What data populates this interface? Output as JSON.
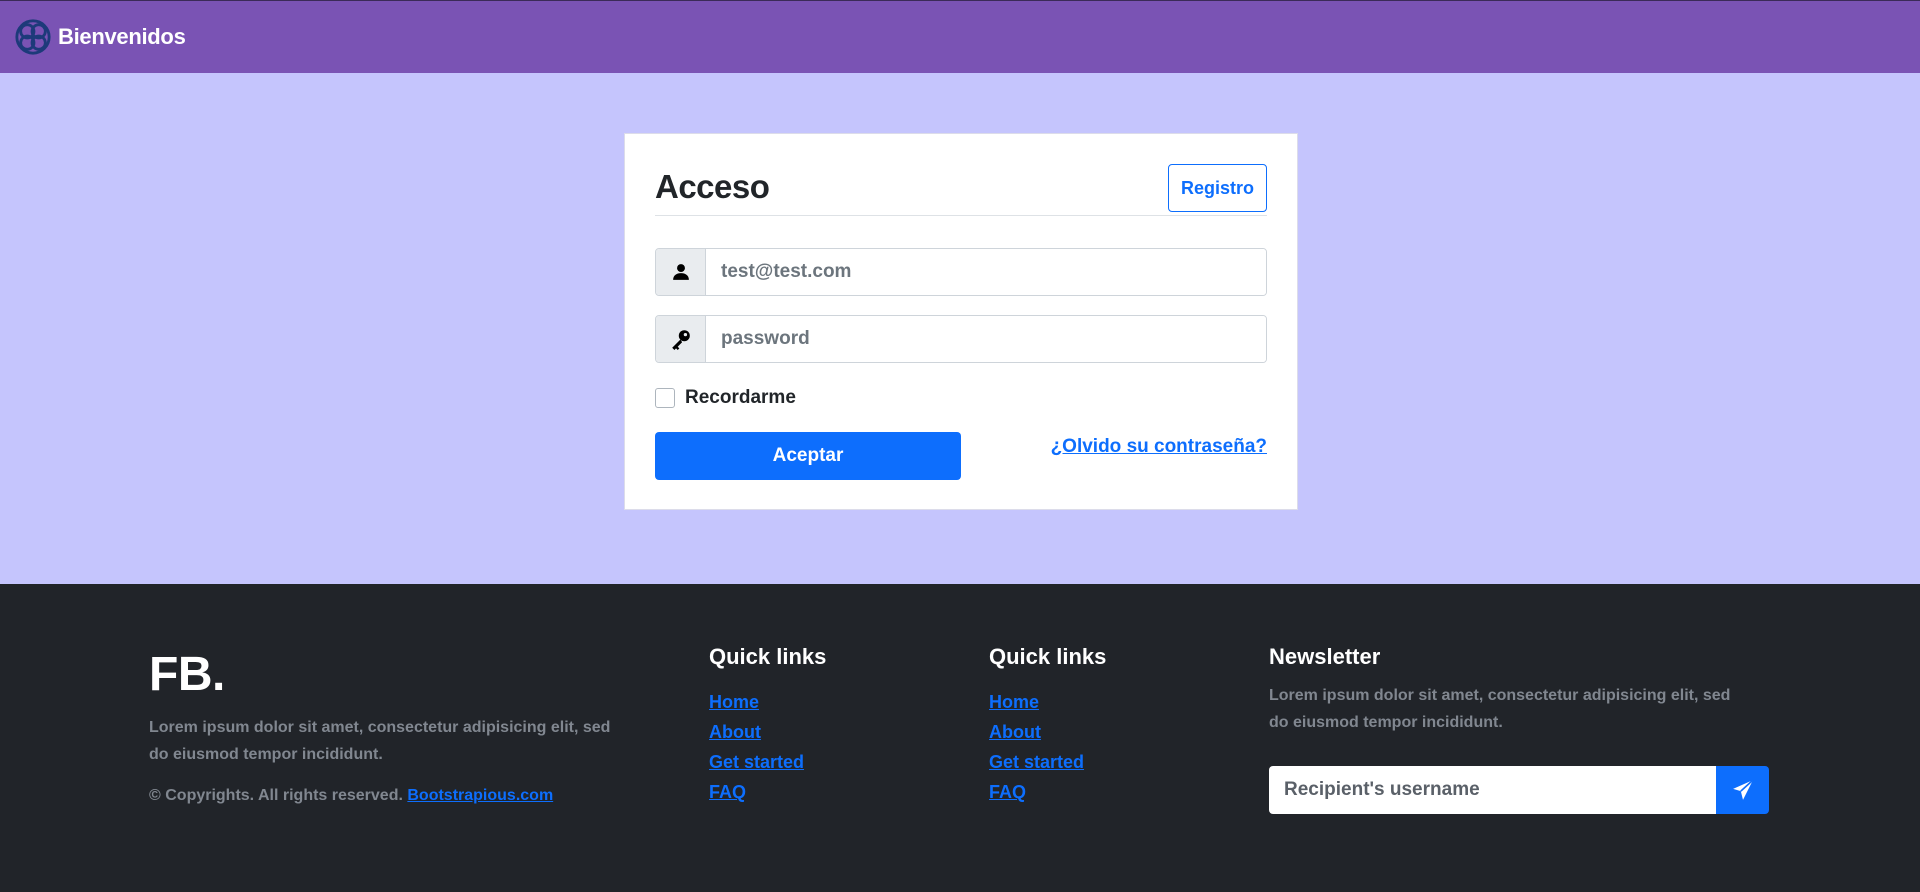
{
  "navbar": {
    "brand": "Bienvenidos",
    "logo_icon": "celtic-knot-logo"
  },
  "login": {
    "title": "Acceso",
    "register_label": "Registro",
    "email_placeholder": "test@test.com",
    "password_placeholder": "password",
    "remember_label": "Recordarme",
    "submit_label": "Aceptar",
    "forgot_label": "¿Olvido su contraseña?"
  },
  "footer": {
    "brand": "FB.",
    "description": "Lorem ipsum dolor sit amet, consectetur adipisicing elit, sed do eiusmod tempor incididunt.",
    "copyright": "© Copyrights. All rights reserved.",
    "copyright_link": "Bootstrapious.com",
    "columns": [
      {
        "title": "Quick links",
        "links": [
          "Home",
          "About",
          "Get started",
          "FAQ"
        ]
      },
      {
        "title": "Quick links",
        "links": [
          "Home",
          "About",
          "Get started",
          "FAQ"
        ]
      }
    ],
    "newsletter": {
      "title": "Newsletter",
      "description": "Lorem ipsum dolor sit amet, consectetur adipisicing elit, sed do eiusmod tempor incididunt.",
      "placeholder": "Recipient's username",
      "send_icon": "paper-plane-icon"
    }
  },
  "colors": {
    "navbar": "#7a53b4",
    "background": "#c5c5fd",
    "primary": "#0d6efd",
    "footer": "#212429"
  }
}
